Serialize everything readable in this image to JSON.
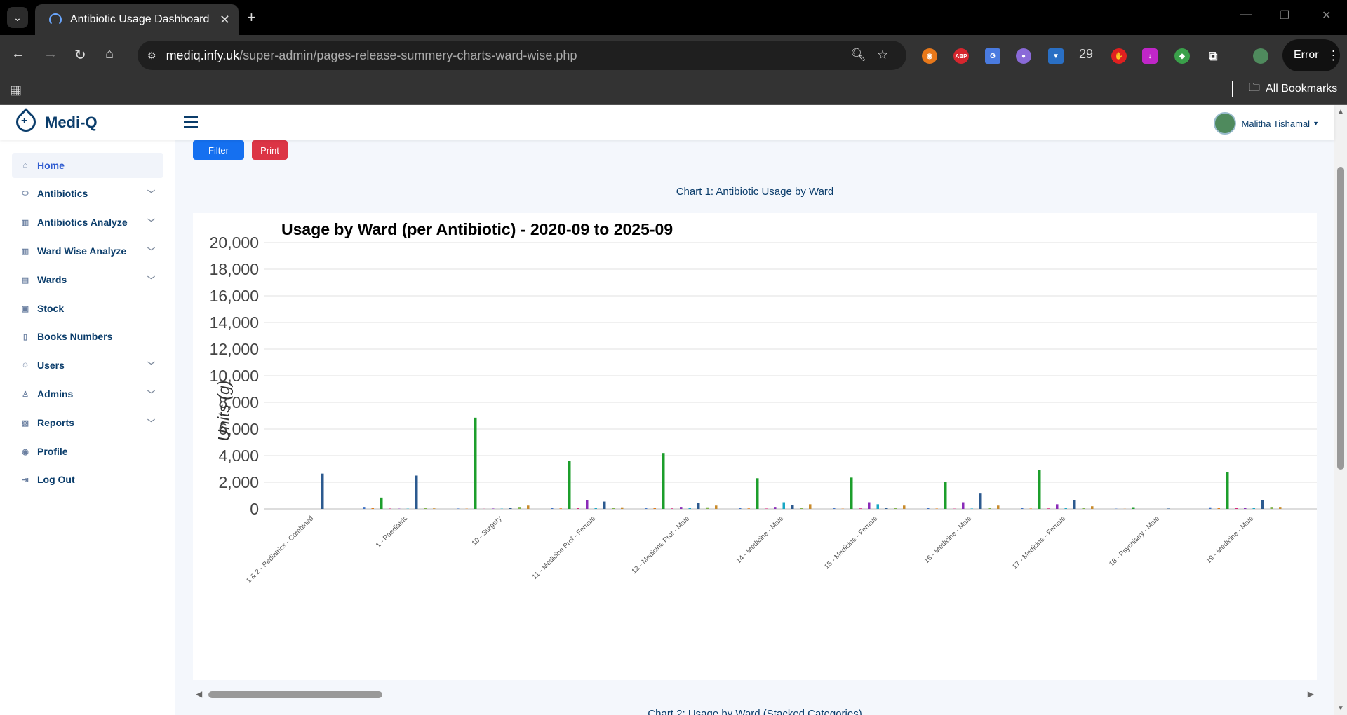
{
  "browser": {
    "tab_title": "Antibiotic Usage Dashboard",
    "url_host": "mediq.infy.uk",
    "url_path": "/super-admin/pages-release-summery-charts-ward-wise.php",
    "extension_badge": "29",
    "error_label": "Error",
    "bookmarks_label": "All Bookmarks"
  },
  "app": {
    "brand": "Medi-Q",
    "user_name": "Malitha Tishamal"
  },
  "sidebar": {
    "items": [
      {
        "label": "Home",
        "icon": "home-icon",
        "active": true,
        "expandable": false
      },
      {
        "label": "Antibiotics",
        "icon": "capsule-icon",
        "expandable": true
      },
      {
        "label": "Antibiotics Analyze",
        "icon": "bar-chart-icon",
        "expandable": true
      },
      {
        "label": "Ward Wise Analyze",
        "icon": "bar-chart-icon",
        "expandable": true
      },
      {
        "label": "Wards",
        "icon": "building-icon",
        "expandable": true
      },
      {
        "label": "Stock",
        "icon": "clipboard-icon",
        "expandable": false
      },
      {
        "label": "Books Numbers",
        "icon": "book-icon",
        "expandable": false
      },
      {
        "label": "Users",
        "icon": "users-icon",
        "expandable": true
      },
      {
        "label": "Admins",
        "icon": "admin-icon",
        "expandable": true
      },
      {
        "label": "Reports",
        "icon": "report-icon",
        "expandable": true
      },
      {
        "label": "Profile",
        "icon": "profile-icon",
        "expandable": false
      },
      {
        "label": "Log Out",
        "icon": "logout-icon",
        "expandable": false
      }
    ]
  },
  "actions": {
    "filter_label": "Filter",
    "print_label": "Print"
  },
  "chart_section": {
    "heading": "Chart 1: Antibiotic Usage by Ward",
    "next_heading": "Chart 2: Usage by Ward (Stacked Categories)"
  },
  "chart_data": {
    "type": "bar",
    "title": "Usage by Ward (per Antibiotic) - 2020-09 to 2025-09",
    "ylabel": "Units (g)",
    "xlabel": "",
    "ylim": [
      0,
      20000
    ],
    "y_ticks": [
      "0",
      "2,000",
      "4,000",
      "6,000",
      "8,000",
      "10,000",
      "12,000",
      "14,000",
      "16,000",
      "18,000",
      "20,000"
    ],
    "y_tick_values": [
      0,
      2000,
      4000,
      6000,
      8000,
      10000,
      12000,
      14000,
      16000,
      18000,
      20000
    ],
    "grid": true,
    "legend": "none",
    "categories": [
      "1 & 2 - Pediatrics - Combined",
      "1 - Paediatric",
      "10 - Surgery",
      "11 - Medicine Prof - Female",
      "12 - Medicine Prof - Male",
      "14 - Medicine - Male",
      "15 - Medicine - Female",
      "16 - Medicine - Male",
      "17 - Medicine - Female",
      "18 - Psychiatry - Male",
      "19 - Medicine - Male"
    ],
    "series": [
      {
        "color": "#3b6fc4",
        "values": [
          0,
          150,
          30,
          60,
          50,
          80,
          50,
          60,
          60,
          20,
          120
        ]
      },
      {
        "color": "#e07b1a",
        "values": [
          0,
          60,
          20,
          40,
          60,
          40,
          20,
          30,
          30,
          10,
          60
        ]
      },
      {
        "color": "#1c9e2b",
        "values": [
          0,
          850,
          6850,
          3600,
          4200,
          2300,
          2350,
          2050,
          2900,
          130,
          2750
        ]
      },
      {
        "color": "#d4267a",
        "values": [
          0,
          30,
          10,
          80,
          40,
          30,
          40,
          20,
          40,
          0,
          60
        ]
      },
      {
        "color": "#8a2bb8",
        "values": [
          0,
          20,
          30,
          650,
          150,
          150,
          500,
          500,
          350,
          0,
          80
        ]
      },
      {
        "color": "#18a7c4",
        "values": [
          0,
          20,
          20,
          70,
          60,
          500,
          350,
          30,
          100,
          0,
          60
        ]
      },
      {
        "color": "#2c5a8f",
        "values": [
          2650,
          2500,
          100,
          550,
          430,
          300,
          100,
          1150,
          650,
          30,
          650
        ]
      },
      {
        "color": "#7fb34a",
        "values": [
          0,
          100,
          150,
          100,
          120,
          80,
          60,
          60,
          80,
          0,
          150
        ]
      },
      {
        "color": "#c98b2c",
        "values": [
          0,
          40,
          250,
          120,
          250,
          350,
          250,
          250,
          200,
          0,
          150
        ]
      }
    ]
  }
}
